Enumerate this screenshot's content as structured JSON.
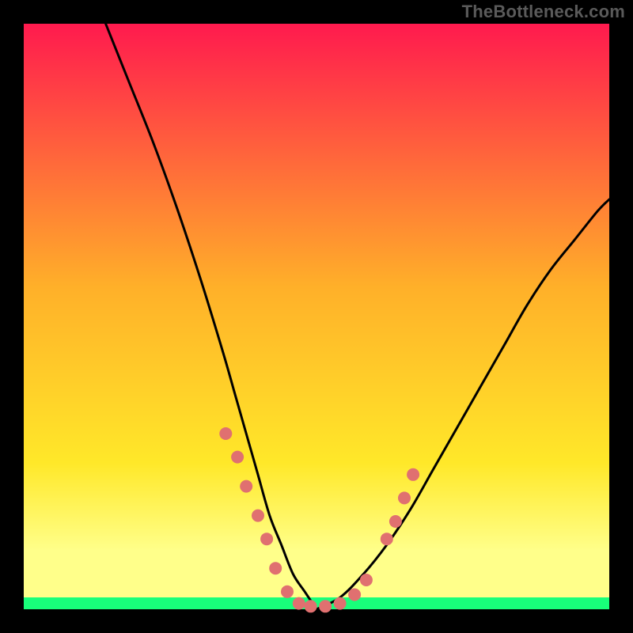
{
  "watermark": "TheBottleneck.com",
  "chart_data": {
    "type": "line",
    "title": "",
    "xlabel": "",
    "ylabel": "",
    "xlim": [
      0,
      100
    ],
    "ylim": [
      0,
      100
    ],
    "background_gradient": {
      "top": "#ff1a4e",
      "mid1": "#ffb029",
      "mid2": "#ffe829",
      "band_light": "#ffff8a",
      "bottom": "#18ff7a"
    },
    "series": [
      {
        "name": "left-curve",
        "color": "#000000",
        "x": [
          14,
          18,
          22,
          26,
          30,
          34,
          36,
          38,
          40,
          42,
          44,
          46,
          48,
          50
        ],
        "y": [
          100,
          90,
          80,
          69,
          57,
          44,
          37,
          30,
          23,
          16,
          11,
          6,
          3,
          0
        ]
      },
      {
        "name": "right-curve",
        "color": "#000000",
        "x": [
          50,
          54,
          58,
          62,
          66,
          70,
          74,
          78,
          82,
          86,
          90,
          94,
          98,
          100
        ],
        "y": [
          0,
          2,
          6,
          11,
          17,
          24,
          31,
          38,
          45,
          52,
          58,
          63,
          68,
          70
        ]
      }
    ],
    "dots": {
      "color": "#e07070",
      "radius_px": 8,
      "points": [
        {
          "x": 34.5,
          "y": 30
        },
        {
          "x": 36.5,
          "y": 26
        },
        {
          "x": 38.0,
          "y": 21
        },
        {
          "x": 40.0,
          "y": 16
        },
        {
          "x": 41.5,
          "y": 12
        },
        {
          "x": 43.0,
          "y": 7
        },
        {
          "x": 45.0,
          "y": 3
        },
        {
          "x": 47.0,
          "y": 1
        },
        {
          "x": 49.0,
          "y": 0.5
        },
        {
          "x": 51.5,
          "y": 0.5
        },
        {
          "x": 54.0,
          "y": 1
        },
        {
          "x": 56.5,
          "y": 2.5
        },
        {
          "x": 58.5,
          "y": 5
        },
        {
          "x": 62.0,
          "y": 12
        },
        {
          "x": 63.5,
          "y": 15
        },
        {
          "x": 65.0,
          "y": 19
        },
        {
          "x": 66.5,
          "y": 23
        }
      ]
    }
  }
}
